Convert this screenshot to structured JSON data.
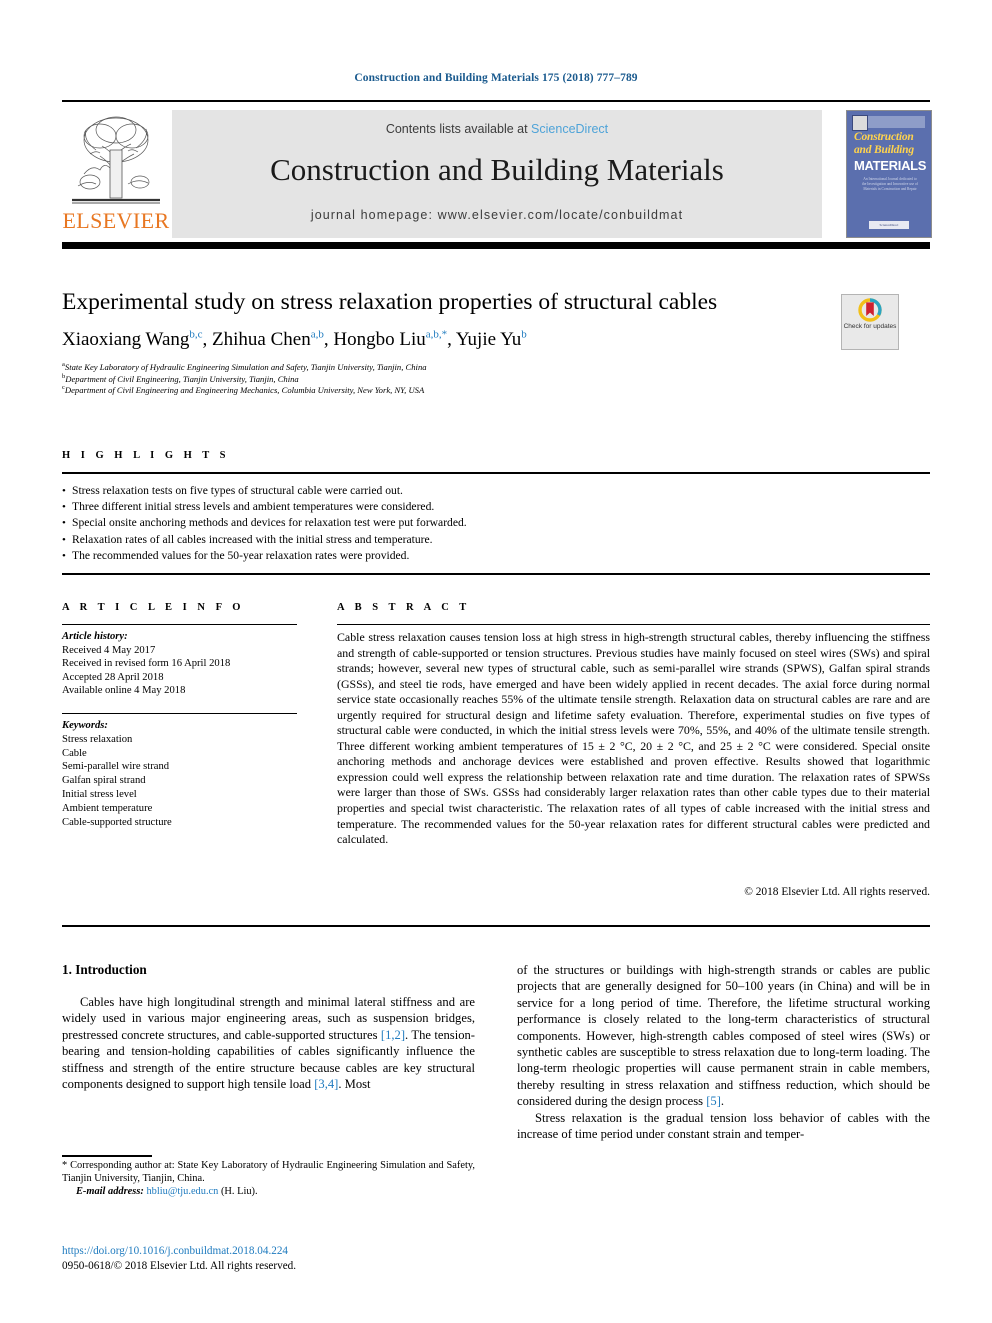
{
  "running_head": "Construction and Building Materials 175 (2018) 777–789",
  "masthead": {
    "contents_prefix": "Contents lists available at ",
    "sciencedirect": "ScienceDirect",
    "journal_title": "Construction and Building Materials",
    "homepage": "journal homepage: www.elsevier.com/locate/conbuildmat",
    "publisher": "ELSEVIER",
    "publisher_logo_icon": "elsevier-tree-icon",
    "cover": {
      "line1": "Construction",
      "line2": "and Building",
      "line3": "MATERIALS",
      "blurb": "An International Journal dedicated to the Investigation and Innovative use of Materials in Construction and Repair",
      "foot": "ScienceDirect"
    }
  },
  "article": {
    "title": "Experimental study on stress relaxation properties of structural cables",
    "authors": [
      {
        "name": "Xiaoxiang Wang",
        "marks": "b,c",
        "sep": ", "
      },
      {
        "name": "Zhihua Chen",
        "marks": "a,b",
        "sep": ", "
      },
      {
        "name": "Hongbo Liu",
        "marks": "a,b,*",
        "sep": ", "
      },
      {
        "name": "Yujie Yu",
        "marks": "b",
        "sep": ""
      }
    ],
    "affiliations": [
      {
        "mark": "a",
        "text": "State Key Laboratory of Hydraulic Engineering Simulation and Safety, Tianjin University, Tianjin, China"
      },
      {
        "mark": "b",
        "text": "Department of Civil Engineering, Tianjin University, Tianjin, China"
      },
      {
        "mark": "c",
        "text": "Department of Civil Engineering and Engineering Mechanics, Columbia University, New York, NY, USA"
      }
    ],
    "crossmark_label": "Check for\nupdates",
    "crossmark_icon": "crossmark-badge-icon"
  },
  "highlights": {
    "heading": "H I G H L I G H T S",
    "items": [
      "Stress relaxation tests on five types of structural cable were carried out.",
      "Three different initial stress levels and ambient temperatures were considered.",
      "Special onsite anchoring methods and devices for relaxation test were put forwarded.",
      "Relaxation rates of all cables increased with the initial stress and temperature.",
      "The recommended values for the 50-year relaxation rates were provided."
    ]
  },
  "article_info": {
    "heading": "A R T I C L E    I N F O",
    "history_label": "Article history:",
    "history": [
      "Received 4 May 2017",
      "Received in revised form 16 April 2018",
      "Accepted 28 April 2018",
      "Available online 4 May 2018"
    ],
    "keywords_label": "Keywords:",
    "keywords": [
      "Stress relaxation",
      "Cable",
      "Semi-parallel wire strand",
      "Galfan spiral strand",
      "Initial stress level",
      "Ambient temperature",
      "Cable-supported structure"
    ]
  },
  "abstract": {
    "heading": "A B S T R A C T",
    "text": "Cable stress relaxation causes tension loss at high stress in high-strength structural cables, thereby influencing the stiffness and strength of cable-supported or tension structures. Previous studies have mainly focused on steel wires (SWs) and spiral strands; however, several new types of structural cable, such as semi-parallel wire strands (SPWS), Galfan spiral strands (GSSs), and steel tie rods, have emerged and have been widely applied in recent decades. The axial force during normal service state occasionally reaches 55% of the ultimate tensile strength. Relaxation data on structural cables are rare and are urgently required for structural design and lifetime safety evaluation. Therefore, experimental studies on five types of structural cable were conducted, in which the initial stress levels were 70%, 55%, and 40% of the ultimate tensile strength. Three different working ambient temperatures of 15 ± 2 °C, 20 ± 2 °C, and 25 ± 2 °C were considered. Special onsite anchoring methods and anchorage devices were established and proven effective. Results showed that logarithmic expression could well express the relationship between relaxation rate and time duration. The relaxation rates of SPWSs were larger than those of SWs. GSSs had considerably larger relaxation rates than other cable types due to their material properties and special twist characteristic. The relaxation rates of all types of cable increased with the initial stress and temperature. The recommended values for the 50-year relaxation rates for different structural cables were predicted and calculated.",
    "copyright": "© 2018 Elsevier Ltd. All rights reserved."
  },
  "body": {
    "section_title": "1. Introduction",
    "left_para_1_a": "Cables have high longitudinal strength and minimal lateral stiffness and are widely used in various major engineering areas, such as suspension bridges, prestressed concrete structures, and cable-supported structures ",
    "left_ref_1": "[1,2]",
    "left_para_1_b": ". The tension-bearing and tension-holding capabilities of cables significantly influence the stiffness and strength of the entire structure because cables are key structural components designed to support high tensile load ",
    "left_ref_2": "[3,4]",
    "left_para_1_c": ". Most",
    "right_para_1_a": "of the structures or buildings with high-strength strands or cables are public projects that are generally designed for 50–100 years (in China) and will be in service for a long period of time. Therefore, the lifetime structural working performance is closely related to the long-term characteristics of structural components. However, high-strength cables composed of steel wires (SWs) or synthetic cables are susceptible to stress relaxation due to long-term loading. The long-term rheologic properties will cause permanent strain in cable members, thereby resulting in stress relaxation and stiffness reduction, which should be considered during the design process ",
    "right_ref_1": "[5]",
    "right_para_1_b": ".",
    "right_para_2": "Stress relaxation is the gradual tension loss behavior of cables with the increase of time period under constant strain and temper-"
  },
  "footnotes": {
    "corresponding_marker": "*",
    "corresponding_text": " Corresponding author at: State Key Laboratory of Hydraulic Engineering Simulation and Safety, Tianjin University, Tianjin, China.",
    "email_label": "E-mail address:",
    "email_link": "hbliu@tju.edu.cn",
    "email_suffix": " (H. Liu).",
    "doi": "https://doi.org/10.1016/j.conbuildmat.2018.04.224",
    "issn_line": "0950-0618/© 2018 Elsevier Ltd. All rights reserved."
  },
  "colors": {
    "link_blue": "#1f7bbf",
    "running_head_blue": "#1a5a8e",
    "elsevier_orange": "#e87722",
    "band_grey": "#e4e4e4",
    "cover_blue": "#5b6fae",
    "cover_yellow": "#ffd34d"
  }
}
